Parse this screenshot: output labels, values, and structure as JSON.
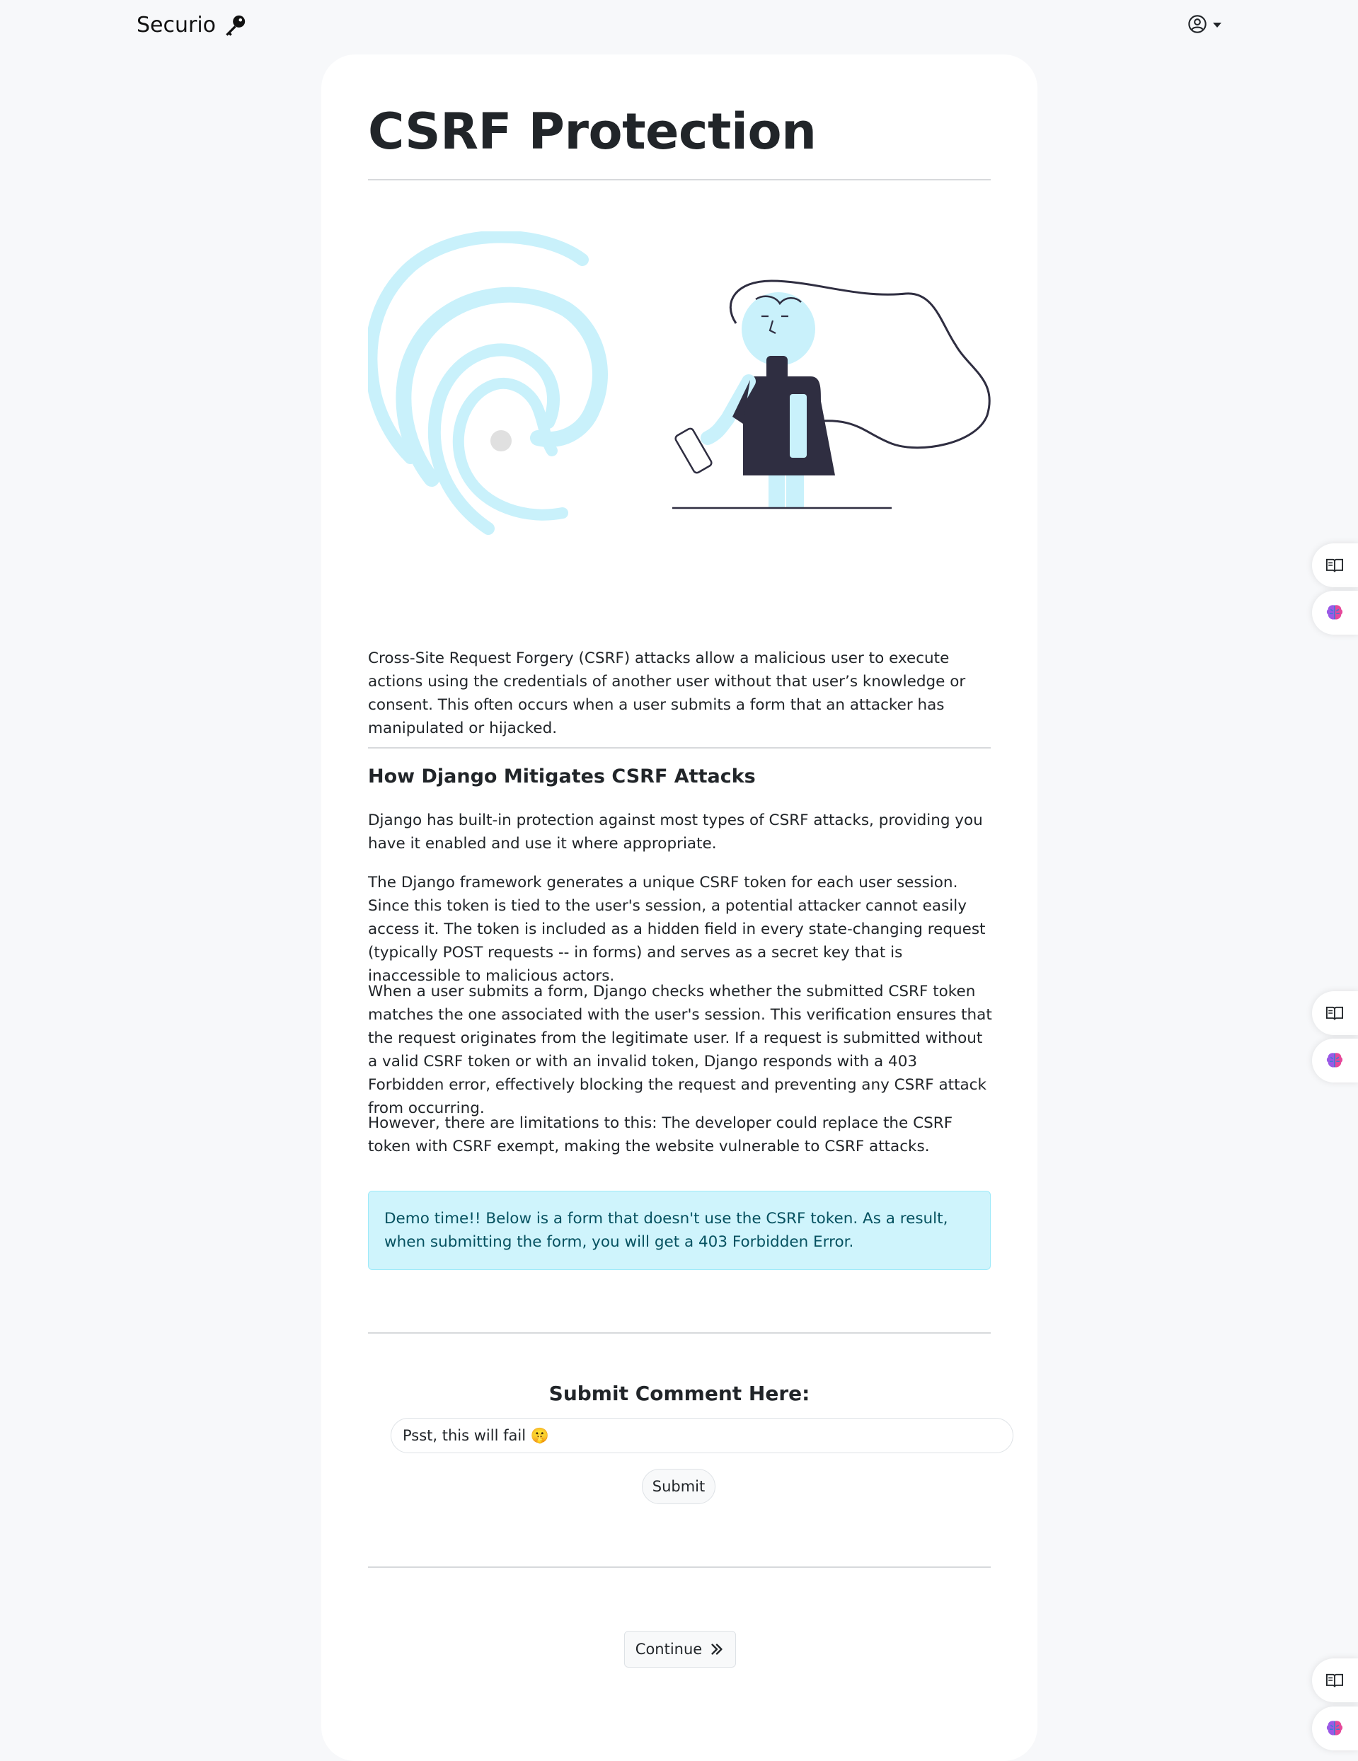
{
  "navbar": {
    "brand": "Securio",
    "brand_icon": "key-icon",
    "user_icon": "user-circle-icon"
  },
  "page": {
    "title": "CSRF Protection",
    "intro": "Cross-Site Request Forgery (CSRF) attacks allow a malicious user to execute actions using the credentials of another user without that user’s knowledge or consent. This often occurs when a user submits a form that an attacker has manipulated or hijacked.",
    "section_heading": "How Django Mitigates CSRF Attacks",
    "paragraphs": [
      "Django has built-in protection against most types of CSRF attacks, providing you have it enabled and use it where appropriate.",
      "The Django framework generates a unique CSRF token for each user session. Since this token is tied to the user's session, a potential attacker cannot easily access it. The token is included as a hidden field in every state-changing request (typically POST requests -- in forms) and serves as a secret key that is inaccessible to malicious actors.",
      "When a user submits a form, Django checks whether the submitted CSRF token matches the one associated with the user's session. This verification ensures that the request originates from the legitimate user. If a request is submitted without a valid CSRF token or with an invalid token, Django responds with a 403 Forbidden error, effectively blocking the request and preventing any CSRF attack from occurring.",
      "However, there are limitations to this: The developer could replace the CSRF token with CSRF exempt, making the website vulnerable to CSRF attacks."
    ],
    "alert": "Demo time!! Below is a form that doesn't use the CSRF token. As a result, when submitting the form, you will get a 403 Forbidden Error."
  },
  "form": {
    "title": "Submit Comment Here:",
    "input_value": "Psst, this will fail 🤫",
    "submit_label": "Submit"
  },
  "footer": {
    "continue_label": "Continue",
    "continue_icon": "chevron-double-right-icon"
  },
  "side_widgets": [
    {
      "icon": "book-icon"
    },
    {
      "icon": "brain-icon"
    },
    {
      "icon": "book-icon"
    },
    {
      "icon": "brain-icon"
    },
    {
      "icon": "book-icon"
    },
    {
      "icon": "brain-icon"
    }
  ],
  "colors": {
    "illustration_light": "#c9f1fb",
    "illustration_dark": "#2f2e41",
    "alert_bg": "#cff4fc",
    "alert_text": "#055160"
  }
}
